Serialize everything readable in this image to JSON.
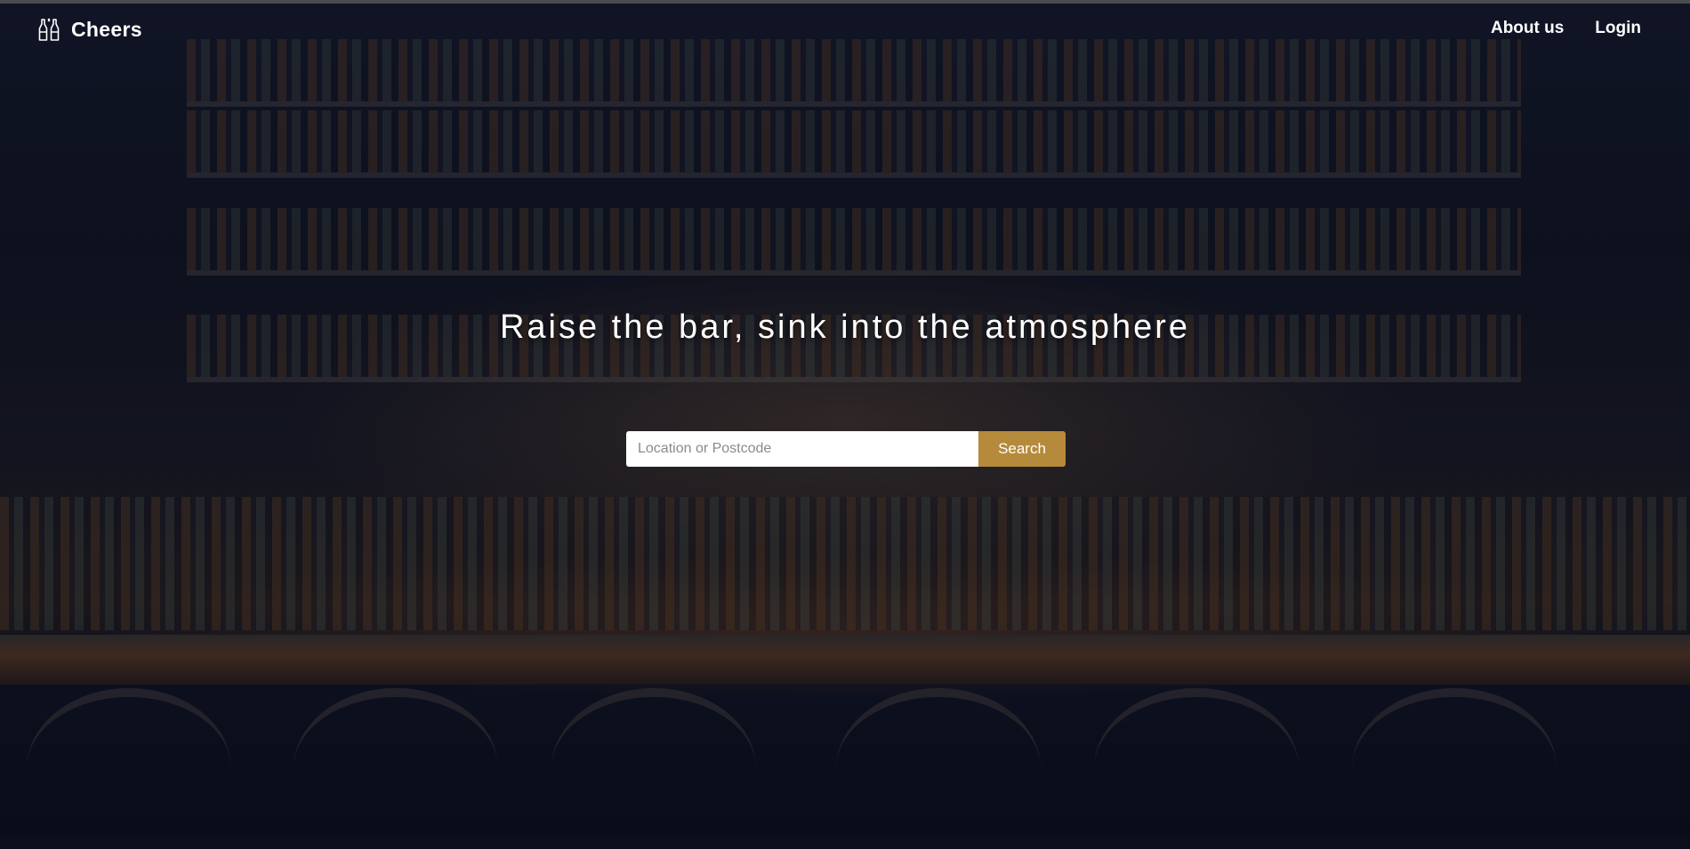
{
  "header": {
    "brand_name": "Cheers",
    "brand_icon": "beer-bottles-icon",
    "nav": [
      {
        "label": "About us"
      },
      {
        "label": "Login"
      }
    ]
  },
  "hero": {
    "headline": "Raise the bar, sink into the atmosphere",
    "search": {
      "placeholder": "Location or Postcode",
      "value": "",
      "button_label": "Search"
    }
  },
  "colors": {
    "accent": "#b68a3b",
    "text": "#ffffff",
    "overlay": "#0b0f1c"
  }
}
